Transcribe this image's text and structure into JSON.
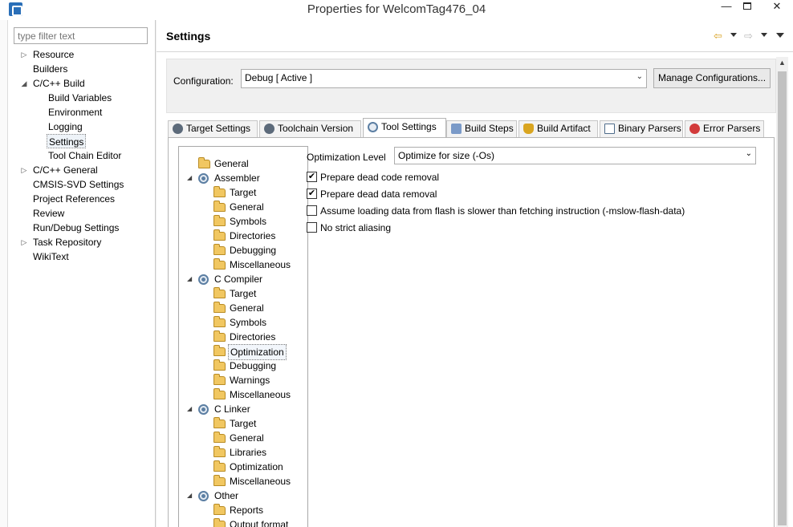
{
  "window": {
    "title": "Properties for WelcomTag476_04",
    "minimize": "—",
    "close": "✕"
  },
  "filter": {
    "placeholder": "type filter text"
  },
  "nav": {
    "items": [
      {
        "label": "Resource",
        "expander": "▷"
      },
      {
        "label": "Builders",
        "expander": ""
      },
      {
        "label": "C/C++ Build",
        "expander": "◢"
      },
      {
        "label": "Build Variables",
        "expander": ""
      },
      {
        "label": "Environment",
        "expander": ""
      },
      {
        "label": "Logging",
        "expander": ""
      },
      {
        "label": "Settings",
        "expander": ""
      },
      {
        "label": "Tool Chain Editor",
        "expander": ""
      },
      {
        "label": "C/C++ General",
        "expander": "▷"
      },
      {
        "label": "CMSIS-SVD Settings",
        "expander": ""
      },
      {
        "label": "Project References",
        "expander": ""
      },
      {
        "label": "Review",
        "expander": ""
      },
      {
        "label": "Run/Debug Settings",
        "expander": ""
      },
      {
        "label": "Task Repository",
        "expander": "▷"
      },
      {
        "label": "WikiText",
        "expander": ""
      }
    ]
  },
  "page": {
    "title": "Settings",
    "back_icon": "⇦",
    "forward_icon": "⇨"
  },
  "configuration": {
    "label": "Configuration:",
    "value": "Debug  [ Active ]",
    "chevron": "⌄",
    "manage_button": "Manage Configurations..."
  },
  "tabs": [
    {
      "label": "Target Settings",
      "icon_color": "#5c6a7a"
    },
    {
      "label": "Toolchain Version",
      "icon_color": "#5c6a7a"
    },
    {
      "label": "Tool Settings",
      "icon_color": "#5c7fa3"
    },
    {
      "label": "Build Steps",
      "icon_color": "#7a9ac8"
    },
    {
      "label": "Build Artifact",
      "icon_color": "#d9a520"
    },
    {
      "label": "Binary Parsers",
      "icon_color": "#4e6b8a"
    },
    {
      "label": "Error Parsers",
      "icon_color": "#d23b3b"
    }
  ],
  "tool_tree": {
    "items": [
      {
        "label": "General"
      },
      {
        "label": "Assembler",
        "expander": "◢"
      },
      {
        "label": "Target"
      },
      {
        "label": "General"
      },
      {
        "label": "Symbols"
      },
      {
        "label": "Directories"
      },
      {
        "label": "Debugging"
      },
      {
        "label": "Miscellaneous"
      },
      {
        "label": "C Compiler",
        "expander": "◢"
      },
      {
        "label": "Target"
      },
      {
        "label": "General"
      },
      {
        "label": "Symbols"
      },
      {
        "label": "Directories"
      },
      {
        "label": "Optimization"
      },
      {
        "label": "Debugging"
      },
      {
        "label": "Warnings"
      },
      {
        "label": "Miscellaneous"
      },
      {
        "label": "C Linker",
        "expander": "◢"
      },
      {
        "label": "Target"
      },
      {
        "label": "General"
      },
      {
        "label": "Libraries"
      },
      {
        "label": "Optimization"
      },
      {
        "label": "Miscellaneous"
      },
      {
        "label": "Other",
        "expander": "◢"
      },
      {
        "label": "Reports"
      },
      {
        "label": "Output format"
      }
    ]
  },
  "optimization": {
    "level_label": "Optimization Level",
    "level_value": "Optimize for size (-Os)",
    "chevron": "⌄",
    "options": [
      {
        "label": "Prepare dead code removal",
        "check": "✔"
      },
      {
        "label": "Prepare dead data removal",
        "check": "✔"
      },
      {
        "label": "Assume loading data from flash is slower than fetching instruction (-mslow-flash-data)",
        "check": ""
      },
      {
        "label": "No strict aliasing",
        "check": ""
      }
    ]
  },
  "scrollbar": {
    "up_arrow": "▲"
  }
}
